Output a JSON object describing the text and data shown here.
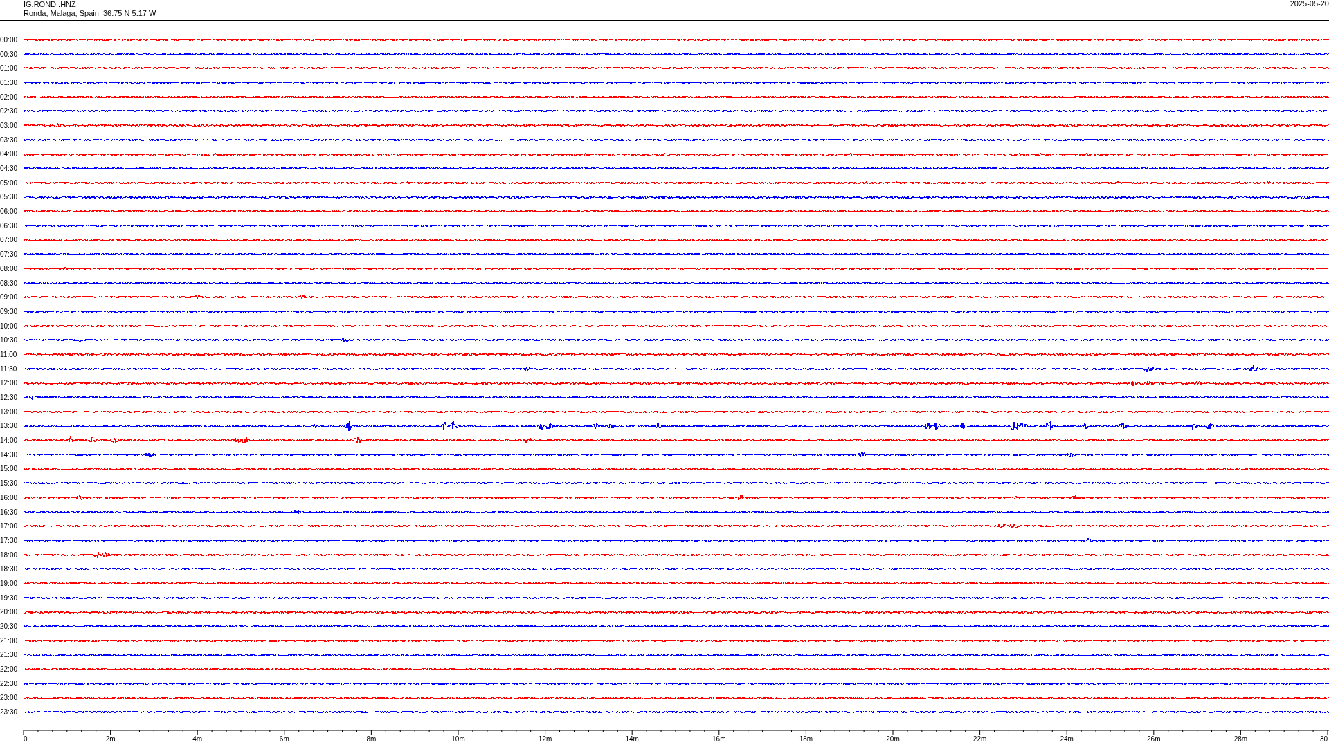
{
  "header": {
    "station": "IG.ROND..HNZ",
    "location": "Ronda, Malaga, Spain  36.75 N 5.17 W",
    "date": "2025-05-20"
  },
  "traces": [
    {
      "time": "00:00",
      "color": "#ff0000"
    },
    {
      "time": "00:30",
      "color": "#0000ff"
    },
    {
      "time": "01:00",
      "color": "#ff0000"
    },
    {
      "time": "01:30",
      "color": "#0000ff"
    },
    {
      "time": "02:00",
      "color": "#ff0000"
    },
    {
      "time": "02:30",
      "color": "#0000ff"
    },
    {
      "time": "03:00",
      "color": "#ff0000"
    },
    {
      "time": "03:30",
      "color": "#0000ff"
    },
    {
      "time": "04:00",
      "color": "#ff0000"
    },
    {
      "time": "04:30",
      "color": "#0000ff"
    },
    {
      "time": "05:00",
      "color": "#ff0000"
    },
    {
      "time": "05:30",
      "color": "#0000ff"
    },
    {
      "time": "06:00",
      "color": "#ff0000"
    },
    {
      "time": "06:30",
      "color": "#0000ff"
    },
    {
      "time": "07:00",
      "color": "#ff0000"
    },
    {
      "time": "07:30",
      "color": "#0000ff"
    },
    {
      "time": "08:00",
      "color": "#ff0000"
    },
    {
      "time": "08:30",
      "color": "#0000ff"
    },
    {
      "time": "09:00",
      "color": "#ff0000"
    },
    {
      "time": "09:30",
      "color": "#0000ff"
    },
    {
      "time": "10:00",
      "color": "#ff0000"
    },
    {
      "time": "10:30",
      "color": "#0000ff"
    },
    {
      "time": "11:00",
      "color": "#ff0000"
    },
    {
      "time": "11:30",
      "color": "#0000ff"
    },
    {
      "time": "12:00",
      "color": "#ff0000"
    },
    {
      "time": "12:30",
      "color": "#0000ff"
    },
    {
      "time": "13:00",
      "color": "#ff0000"
    },
    {
      "time": "13:30",
      "color": "#0000ff"
    },
    {
      "time": "14:00",
      "color": "#ff0000"
    },
    {
      "time": "14:30",
      "color": "#0000ff"
    },
    {
      "time": "15:00",
      "color": "#ff0000"
    },
    {
      "time": "15:30",
      "color": "#0000ff"
    },
    {
      "time": "16:00",
      "color": "#ff0000"
    },
    {
      "time": "16:30",
      "color": "#0000ff"
    },
    {
      "time": "17:00",
      "color": "#ff0000"
    },
    {
      "time": "17:30",
      "color": "#0000ff"
    },
    {
      "time": "18:00",
      "color": "#ff0000"
    },
    {
      "time": "18:30",
      "color": "#0000ff"
    },
    {
      "time": "19:00",
      "color": "#ff0000"
    },
    {
      "time": "19:30",
      "color": "#0000ff"
    },
    {
      "time": "20:00",
      "color": "#ff0000"
    },
    {
      "time": "20:30",
      "color": "#0000ff"
    },
    {
      "time": "21:00",
      "color": "#ff0000"
    },
    {
      "time": "21:30",
      "color": "#0000ff"
    },
    {
      "time": "22:00",
      "color": "#ff0000"
    },
    {
      "time": "22:30",
      "color": "#0000ff"
    },
    {
      "time": "23:00",
      "color": "#ff0000"
    },
    {
      "time": "23:30",
      "color": "#0000ff"
    }
  ],
  "time_axis": {
    "labels": [
      "0",
      "2m",
      "4m",
      "6m",
      "8m",
      "10m",
      "12m",
      "14m",
      "16m",
      "18m",
      "20m",
      "22m",
      "24m",
      "26m",
      "28m",
      "30"
    ]
  }
}
